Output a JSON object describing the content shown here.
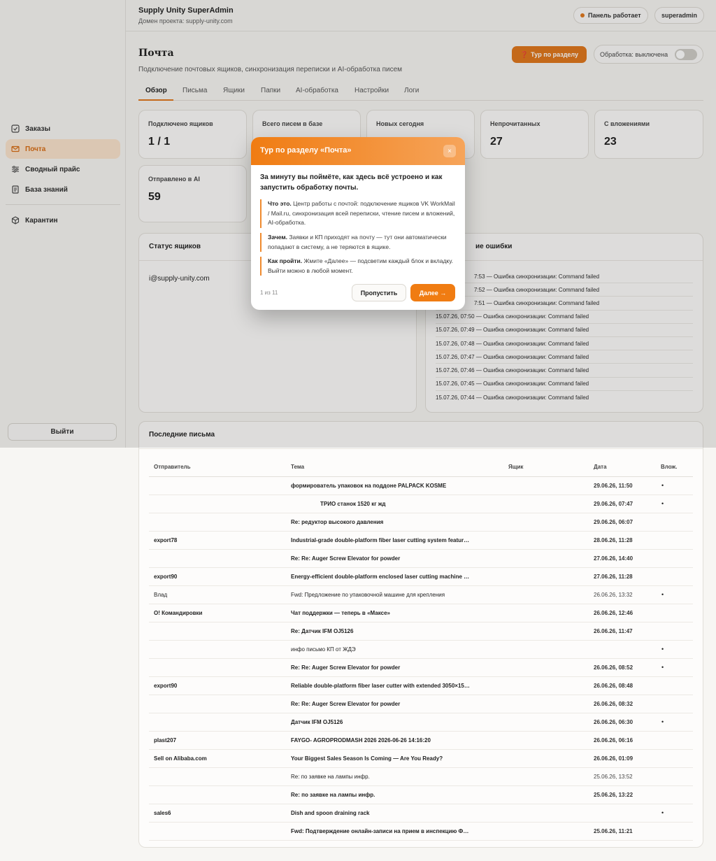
{
  "header": {
    "app_title": "Supply Unity SuperAdmin",
    "domain": "Домен проекта: supply-unity.com",
    "status": "Панель работает",
    "user": "superadmin"
  },
  "sidebar": {
    "items": [
      {
        "label": "Заказы",
        "icon": "checkbox-icon"
      },
      {
        "label": "Почта",
        "icon": "mail-icon"
      },
      {
        "label": "Сводный прайс",
        "icon": "sliders-icon"
      },
      {
        "label": "База знаний",
        "icon": "book-icon"
      },
      {
        "label": "Карантин",
        "icon": "cube-icon"
      }
    ],
    "logout": "Выйти"
  },
  "page": {
    "title": "Почта",
    "subtitle": "Подключение почтовых ящиков, синхронизация переписки и AI-обработка писем",
    "tour_button": "Тур по разделу",
    "processing_label": "Обработка: выключена",
    "processing_enabled": false
  },
  "tabs": [
    "Обзор",
    "Письма",
    "Ящики",
    "Папки",
    "AI-обработка",
    "Настройки",
    "Логи"
  ],
  "stats": [
    {
      "label": "Подключено ящиков",
      "value": "1 / 1"
    },
    {
      "label": "Всего писем в базе",
      "value": ""
    },
    {
      "label": "Новых сегодня",
      "value": ""
    },
    {
      "label": "Непрочитанных",
      "value": "27"
    },
    {
      "label": "С вложениями",
      "value": "23"
    },
    {
      "label": "Отправлено в AI",
      "value": "59"
    }
  ],
  "mailbox_status": {
    "title": "Статус ящиков",
    "mailbox": "i@supply-unity.com"
  },
  "errors": {
    "title_visible": "ие ошибки",
    "rows": [
      "7:53 — Ошибка синхронизации: Command failed",
      "7:52 — Ошибка синхронизации: Command failed",
      "7:51 — Ошибка синхронизации: Command failed",
      "15.07.26, 07:50 — Ошибка синхронизации: Command failed",
      "15.07.26, 07:49 — Ошибка синхронизации: Command failed",
      "15.07.26, 07:48 — Ошибка синхронизации: Command failed",
      "15.07.26, 07:47 — Ошибка синхронизации: Command failed",
      "15.07.26, 07:46 — Ошибка синхронизации: Command failed",
      "15.07.26, 07:45 — Ошибка синхронизации: Command failed",
      "15.07.26, 07:44 — Ошибка синхронизации: Command failed"
    ]
  },
  "emails": {
    "title": "Последние письма",
    "columns": [
      "Отправитель",
      "Тема",
      "Ящик",
      "Дата",
      "Влож."
    ],
    "rows": [
      {
        "sender": "",
        "subject": "формирователь упаковок на поддоне PALPACK KOSME",
        "box": "",
        "date": "29.06.26, 11:50",
        "att": "•",
        "bold": true
      },
      {
        "sender": "",
        "subject": "ТРИО станок 1520 кг жд",
        "box": "",
        "date": "29.06.26, 07:47",
        "att": "•",
        "bold": true,
        "indent": true
      },
      {
        "sender": "",
        "subject": "Re: редуктор высокого давления",
        "box": "",
        "date": "29.06.26, 06:07",
        "att": "",
        "bold": true
      },
      {
        "sender": "export78",
        "subject": "Industrial-grade double-platform fiber laser cutting system featur…",
        "box": "",
        "date": "28.06.26, 11:28",
        "att": "",
        "bold": true
      },
      {
        "sender": "",
        "subject": "Re: Re: Auger Screw Elevator for powder",
        "box": "",
        "date": "27.06.26, 14:40",
        "att": "",
        "bold": true
      },
      {
        "sender": "export90",
        "subject": "Energy-efficient double-platform enclosed laser cutting machine …",
        "box": "",
        "date": "27.06.26, 11:28",
        "att": "",
        "bold": true
      },
      {
        "sender": "Влад",
        "subject": "Fwd: Предложение по упаковочной машине для крепления",
        "box": "",
        "date": "26.06.26, 13:32",
        "att": "•",
        "bold": false
      },
      {
        "sender": "О! Командировки",
        "subject": "Чат поддержки — теперь в «Максе»",
        "box": "",
        "date": "26.06.26, 12:46",
        "att": "",
        "bold": true
      },
      {
        "sender": "",
        "subject": "Re: Датчик IFM OJ5126",
        "box": "",
        "date": "26.06.26, 11:47",
        "att": "",
        "bold": true
      },
      {
        "sender": "",
        "subject": "инфо письмо КП от ЖДЭ",
        "box": "",
        "date": "",
        "att": "•",
        "bold": false
      },
      {
        "sender": "",
        "subject": "Re: Re: Auger Screw Elevator for powder",
        "box": "",
        "date": "26.06.26, 08:52",
        "att": "•",
        "bold": true
      },
      {
        "sender": "export90",
        "subject": "Reliable double-platform fiber laser cutter with extended 3050×15…",
        "box": "",
        "date": "26.06.26, 08:48",
        "att": "",
        "bold": true
      },
      {
        "sender": "",
        "subject": "Re: Re: Auger Screw Elevator for powder",
        "box": "",
        "date": "26.06.26, 08:32",
        "att": "",
        "bold": true
      },
      {
        "sender": "",
        "subject": "Датчик IFM OJ5126",
        "box": "",
        "date": "26.06.26, 06:30",
        "att": "•",
        "bold": true
      },
      {
        "sender": "plast207",
        "subject": "FAYGO- AGROPRODMASH 2026 2026-06-26 14:16:20",
        "box": "",
        "date": "26.06.26, 06:16",
        "att": "",
        "bold": true
      },
      {
        "sender": "Sell on Alibaba.com",
        "subject": "Your Biggest Sales Season Is Coming — Are You Ready?",
        "box": "",
        "date": "26.06.26, 01:09",
        "att": "",
        "bold": true
      },
      {
        "sender": "",
        "subject": "Re: по заявке на лампы инфр.",
        "box": "",
        "date": "25.06.26, 13:52",
        "att": "",
        "bold": false
      },
      {
        "sender": "",
        "subject": "Re: по заявке на лампы инфр.",
        "box": "",
        "date": "25.06.26, 13:22",
        "att": "",
        "bold": true
      },
      {
        "sender": "sales6",
        "subject": "Dish and spoon draining rack",
        "box": "",
        "date": "",
        "att": "•",
        "bold": true
      },
      {
        "sender": "",
        "subject": "Fwd: Подтверждение онлайн-записи на прием в инспекцию Ф…",
        "box": "",
        "date": "25.06.26, 11:21",
        "att": "",
        "bold": true
      }
    ]
  },
  "tour": {
    "title": "Тур по разделу «Почта»",
    "close": "×",
    "intro": "За минуту вы поймёте, как здесь всё устроено и как запустить обработку почты.",
    "tips": [
      {
        "label": "Что это.",
        "text": " Центр работы с почтой: подключение ящиков VK WorkMail / Mail.ru, синхронизация всей переписки, чтение писем и вложений, AI-обработка."
      },
      {
        "label": "Зачем.",
        "text": " Заявки и КП приходят на почту — тут они автоматически попадают в систему, а не теряются в ящике."
      },
      {
        "label": "Как пройти.",
        "text": " Жмите «Далее» — подсветим каждый блок и вкладку. Выйти можно в любой момент."
      }
    ],
    "step": "1 из 11",
    "skip": "Пропустить",
    "next": "Далее →"
  },
  "colors": {
    "accent": "#e0761a",
    "sidebar_active_bg": "#fbe3cc",
    "overlay": "rgba(30,30,30,0.14)"
  }
}
